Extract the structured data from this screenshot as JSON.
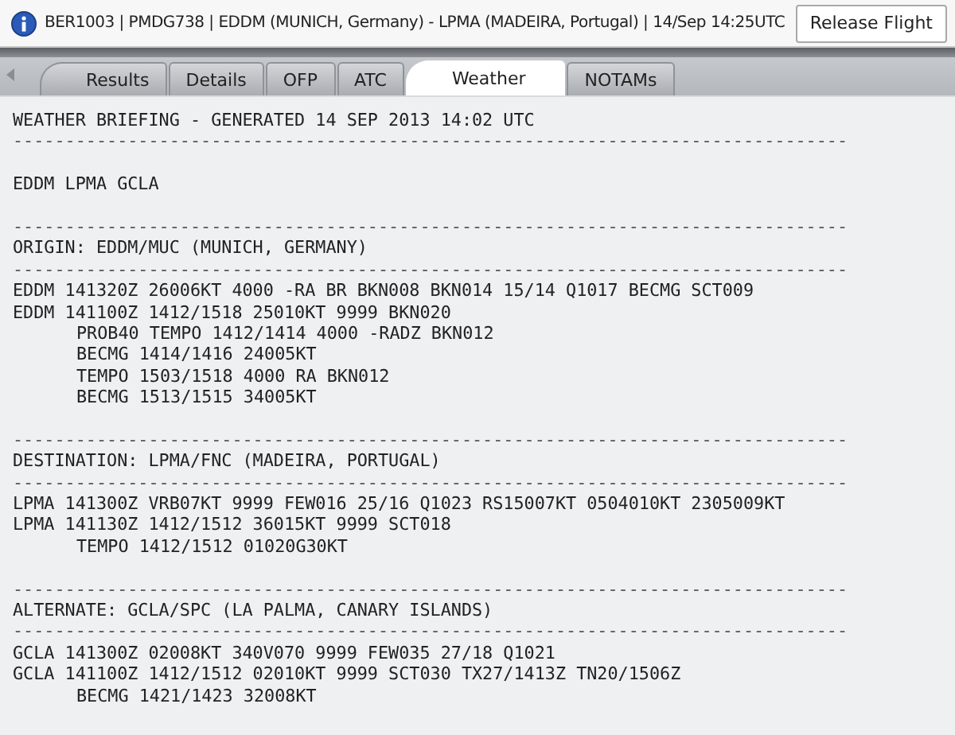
{
  "header": {
    "title": "BER1003 | PMDG738 | EDDM (MUNICH, Germany) - LPMA (MADEIRA, Portugal) | 14/Sep 14:25UTC",
    "button": "Release Flight"
  },
  "tabs": [
    {
      "label": "Results",
      "selected": false
    },
    {
      "label": "Details",
      "selected": false
    },
    {
      "label": "OFP",
      "selected": false
    },
    {
      "label": "ATC",
      "selected": false
    },
    {
      "label": "Weather",
      "selected": true
    },
    {
      "label": "NOTAMs",
      "selected": false
    }
  ],
  "briefing": {
    "lines": [
      {
        "kind": "text",
        "text": "WEATHER BRIEFING - GENERATED 14 SEP 2013 14:02 UTC"
      },
      {
        "kind": "rule",
        "text": "--------------------------------------------------------------------------------"
      },
      {
        "kind": "blank"
      },
      {
        "kind": "text",
        "text": "EDDM LPMA GCLA"
      },
      {
        "kind": "blank"
      },
      {
        "kind": "rule",
        "text": "--------------------------------------------------------------------------------"
      },
      {
        "kind": "heading",
        "text": "ORIGIN: EDDM/MUC (MUNICH, GERMANY)"
      },
      {
        "kind": "rule",
        "text": "--------------------------------------------------------------------------------"
      },
      {
        "kind": "text",
        "text": "EDDM 141320Z 26006KT 4000 -RA BR BKN008 BKN014 15/14 Q1017 BECMG SCT009"
      },
      {
        "kind": "text",
        "text": "EDDM 141100Z 1412/1518 25010KT 9999 BKN020",
        "children": [
          "PROB40 TEMPO 1412/1414 4000 -RADZ BKN012",
          "BECMG 1414/1416 24005KT",
          "TEMPO 1503/1518 4000 RA BKN012",
          "BECMG 1513/1515 34005KT"
        ]
      },
      {
        "kind": "blank"
      },
      {
        "kind": "rule",
        "text": "--------------------------------------------------------------------------------"
      },
      {
        "kind": "heading",
        "text": "DESTINATION: LPMA/FNC (MADEIRA, PORTUGAL)"
      },
      {
        "kind": "rule",
        "text": "--------------------------------------------------------------------------------"
      },
      {
        "kind": "text",
        "text": "LPMA 141300Z VRB07KT 9999 FEW016 25/16 Q1023 RS15007KT 0504010KT 2305009KT"
      },
      {
        "kind": "text",
        "text": "LPMA 141130Z 1412/1512 36015KT 9999 SCT018",
        "children": [
          "TEMPO 1412/1512 01020G30KT"
        ]
      },
      {
        "kind": "blank"
      },
      {
        "kind": "rule",
        "text": "--------------------------------------------------------------------------------"
      },
      {
        "kind": "heading",
        "text": "ALTERNATE: GCLA/SPC (LA PALMA, CANARY ISLANDS)"
      },
      {
        "kind": "rule",
        "text": "--------------------------------------------------------------------------------"
      },
      {
        "kind": "text",
        "text": "GCLA 141300Z 02008KT 340V070 9999 FEW035 27/18 Q1021"
      },
      {
        "kind": "text",
        "text": "GCLA 141100Z 1412/1512 02010KT 9999 SCT030 TX27/1413Z TN20/1506Z",
        "children": [
          "BECMG 1421/1423 32008KT"
        ]
      }
    ]
  }
}
